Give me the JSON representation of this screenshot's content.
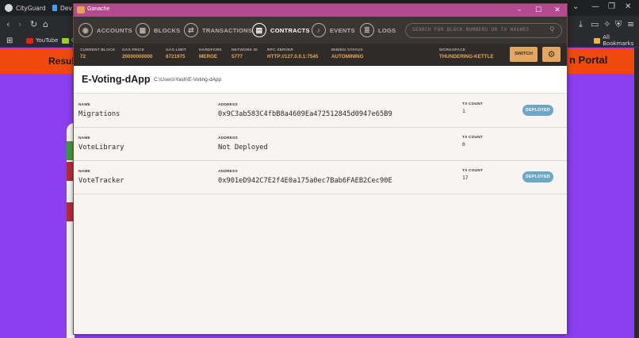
{
  "browser": {
    "tabs": [
      {
        "label": "CityGuard",
        "color": "#d7d7d7"
      },
      {
        "label": "Dev",
        "color": "#3fa0ff"
      }
    ],
    "bookmarks": [
      {
        "label": "YouTube",
        "icon": "youtube-icon"
      },
      {
        "label": "G",
        "icon": "bookmark-icon"
      }
    ],
    "all_bookmarks": "All Bookmarks"
  },
  "site": {
    "left_text": "Result",
    "right_text": "n Portal"
  },
  "ganache": {
    "title": "Ganache",
    "nav": [
      {
        "label": "ACCOUNTS",
        "icon": "accounts-icon",
        "active": false
      },
      {
        "label": "BLOCKS",
        "icon": "blocks-icon",
        "active": false
      },
      {
        "label": "TRANSACTIONS",
        "icon": "transactions-icon",
        "active": false
      },
      {
        "label": "CONTRACTS",
        "icon": "contracts-icon",
        "active": true
      },
      {
        "label": "EVENTS",
        "icon": "events-icon",
        "active": false
      },
      {
        "label": "LOGS",
        "icon": "logs-icon",
        "active": false
      }
    ],
    "search_placeholder": "SEARCH FOR BLOCK NUMBERS OR TX HASHES",
    "status": {
      "current_block": {
        "label": "CURRENT BLOCK",
        "value": "72"
      },
      "gas_price": {
        "label": "GAS PRICE",
        "value": "20000000000"
      },
      "gas_limit": {
        "label": "GAS LIMIT",
        "value": "6721975"
      },
      "hardfork": {
        "label": "HARDFORK",
        "value": "MERGE"
      },
      "network_id": {
        "label": "NETWORK ID",
        "value": "5777"
      },
      "rpc_server": {
        "label": "RPC SERVER",
        "value": "HTTP://127.0.0.1:7545"
      },
      "mining_status": {
        "label": "MINING STATUS",
        "value": "AUTOMINING"
      },
      "workspace": {
        "label": "WORKSPACE",
        "value": "THUNDERING-KETTLE"
      }
    },
    "switch_label": "SWITCH",
    "project": {
      "name": "E-Voting-dApp",
      "path": "C:\\Users\\Yash\\E-Voting-dApp"
    },
    "col_labels": {
      "name": "NAME",
      "address": "ADDRESS",
      "tx_count": "TX COUNT"
    },
    "contracts": [
      {
        "name": "Migrations",
        "address": "0x9C3ab583C4fbB8a4609Ea472512845d0947e65B9",
        "tx_count": "1",
        "status": "DEPLOYED"
      },
      {
        "name": "VoteLibrary",
        "address": "Not Deployed",
        "tx_count": "0",
        "status": ""
      },
      {
        "name": "VoteTracker",
        "address": "0x901eD942C7E2f4E0a175a0ec7Bab6FAEB2Cec90E",
        "tx_count": "17",
        "status": "DEPLOYED"
      }
    ],
    "colors": {
      "accent": "#e4a663",
      "nav_bg": "#3a3633",
      "title_bar": "#b24a91",
      "badge": "#6fa6c4"
    }
  }
}
